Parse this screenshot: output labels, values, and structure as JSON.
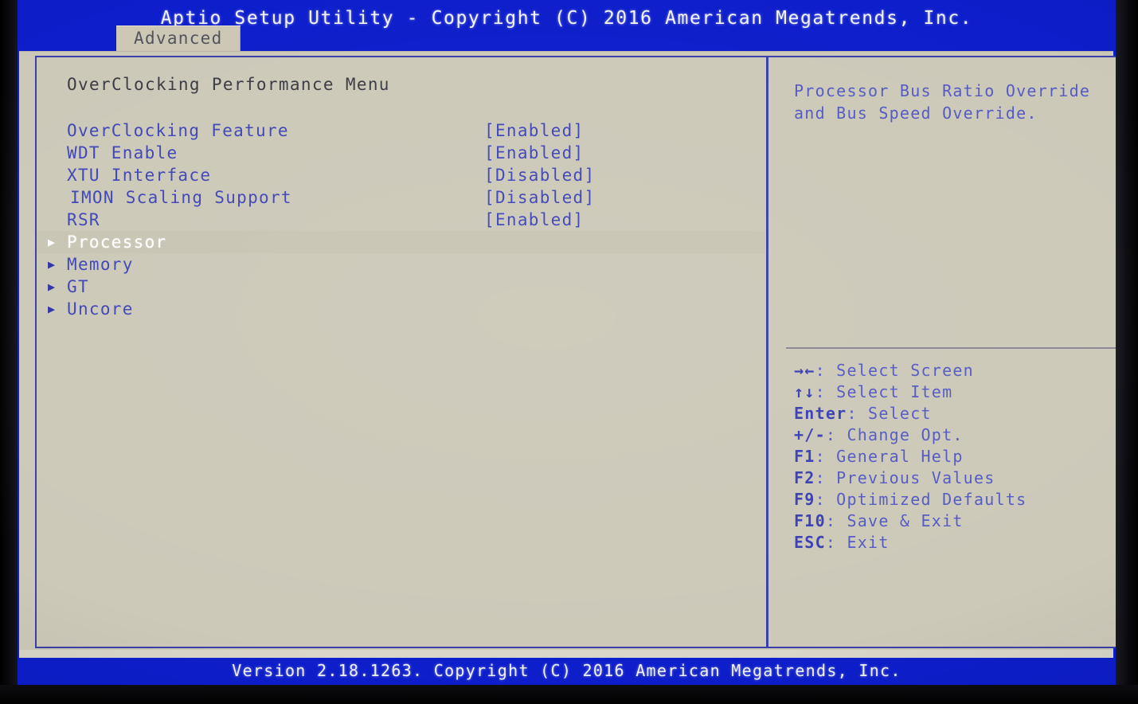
{
  "header": {
    "title": "Aptio Setup Utility - Copyright (C) 2016 American Megatrends, Inc.",
    "tabs": [
      {
        "label": "Advanced",
        "active": true
      }
    ]
  },
  "main": {
    "section_title": "OverClocking Performance Menu",
    "options": [
      {
        "label": "OverClocking Feature",
        "value": "[Enabled]",
        "type": "setting",
        "selected": false,
        "indented": false
      },
      {
        "label": "WDT Enable",
        "value": "[Enabled]",
        "type": "setting",
        "selected": false,
        "indented": false
      },
      {
        "label": "XTU Interface",
        "value": "[Disabled]",
        "type": "setting",
        "selected": false,
        "indented": false
      },
      {
        "label": "IMON Scaling Support",
        "value": "[Disabled]",
        "type": "setting",
        "selected": false,
        "indented": true
      },
      {
        "label": "RSR",
        "value": "[Enabled]",
        "type": "setting",
        "selected": false,
        "indented": false
      },
      {
        "label": "Processor",
        "value": "",
        "type": "submenu",
        "selected": true,
        "indented": false
      },
      {
        "label": "Memory",
        "value": "",
        "type": "submenu",
        "selected": false,
        "indented": false
      },
      {
        "label": "GT",
        "value": "",
        "type": "submenu",
        "selected": false,
        "indented": false
      },
      {
        "label": "Uncore",
        "value": "",
        "type": "submenu",
        "selected": false,
        "indented": false
      }
    ],
    "submenu_arrow_icon": "triangle-right-icon"
  },
  "help": {
    "text": "Processor Bus Ratio Override\nand Bus Speed Override.",
    "legend": [
      {
        "key": "→←",
        "label": ": Select Screen"
      },
      {
        "key": "↑↓",
        "label": ": Select Item"
      },
      {
        "key": "Enter",
        "label": ": Select"
      },
      {
        "key": "+/-",
        "label": ": Change Opt."
      },
      {
        "key": "F1",
        "label": ": General Help"
      },
      {
        "key": "F2",
        "label": ": Previous Values"
      },
      {
        "key": "F9",
        "label": ": Optimized Defaults"
      },
      {
        "key": "F10",
        "label": ": Save & Exit"
      },
      {
        "key": "ESC",
        "label": ": Exit"
      }
    ]
  },
  "footer": {
    "text": "Version 2.18.1263. Copyright (C) 2016 American Megatrends, Inc."
  },
  "colors": {
    "header_blue": "#0d1ecb",
    "panel_beige": "#cdc9b9",
    "text_blue": "#3f46b8",
    "help_blue": "#545ac4",
    "title_dark": "#3b3b43",
    "selected_white": "#ffffff",
    "border_blue": "#3b3fa8",
    "divider_gray": "#8b8796",
    "tab_beige": "#cdc8b6",
    "tab_text": "#52535c"
  }
}
